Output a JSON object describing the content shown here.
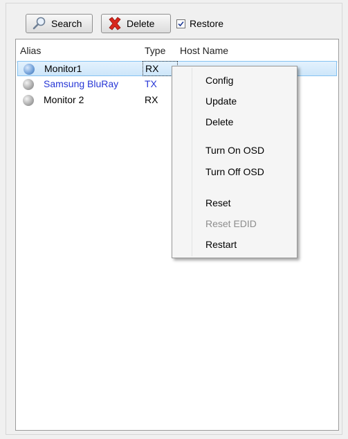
{
  "toolbar": {
    "search_label": "Search",
    "delete_label": "Delete",
    "restore_label": "Restore",
    "restore_checked": true
  },
  "list": {
    "columns": [
      "Alias",
      "Type",
      "Host Name"
    ],
    "rows": [
      {
        "alias": "Monitor1",
        "type": "RX",
        "host": "",
        "selected": true,
        "status_color": "#6f9fd8"
      },
      {
        "alias": "Samsung BluRay",
        "type": "TX",
        "host": "",
        "selected": false,
        "status_color": "#9c9c9c"
      },
      {
        "alias": "Monitor 2",
        "type": "RX",
        "host": "",
        "selected": false,
        "status_color": "#9c9c9c"
      }
    ]
  },
  "context_menu": {
    "items": [
      {
        "label": "Config",
        "enabled": true
      },
      {
        "label": "Update",
        "enabled": true
      },
      {
        "label": "Delete",
        "enabled": true
      },
      {
        "label": "Turn On OSD",
        "enabled": true
      },
      {
        "label": "Turn Off OSD",
        "enabled": true
      },
      {
        "label": "Reset",
        "enabled": true
      },
      {
        "label": "Reset EDID",
        "enabled": false
      },
      {
        "label": "Restart",
        "enabled": true
      }
    ]
  },
  "colors": {
    "tx_text": "#2636d6",
    "selection_border": "#84c2f1",
    "disabled_text": "#8d8d8d"
  }
}
